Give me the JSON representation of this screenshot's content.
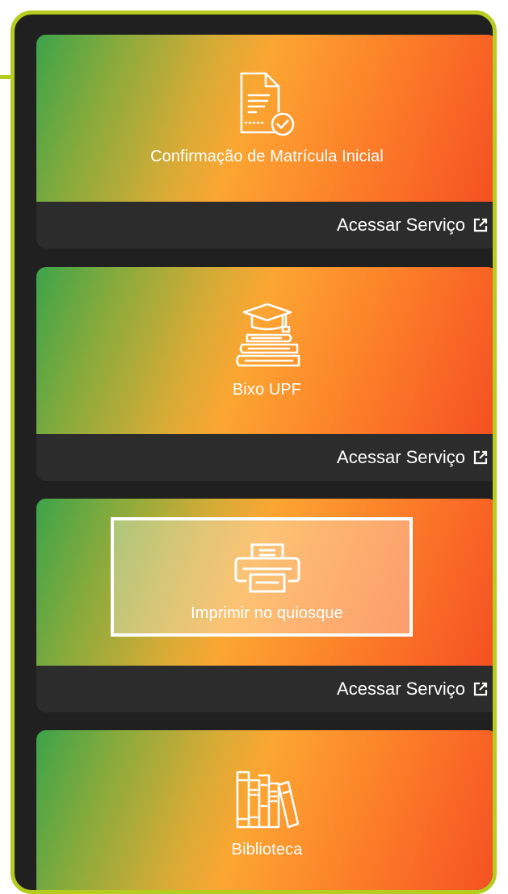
{
  "cards": [
    {
      "title": "Confirmação de Matrícula Inicial",
      "action_label": "Acessar Serviço",
      "icon": "document-check-icon"
    },
    {
      "title": "Bixo UPF",
      "action_label": "Acessar Serviço",
      "icon": "graduation-books-icon"
    },
    {
      "title": "Imprimir no quiosque",
      "action_label": "Acessar Serviço",
      "icon": "printer-icon"
    },
    {
      "title": "Biblioteca",
      "icon": "library-books-icon"
    }
  ],
  "colors": {
    "frame_border": "#b6cc1e",
    "panel_background": "#202020",
    "card_footer": "#2c2c2c",
    "gradient": [
      "#3da34a",
      "#d3ab37",
      "#fca632",
      "#f44f22"
    ]
  }
}
